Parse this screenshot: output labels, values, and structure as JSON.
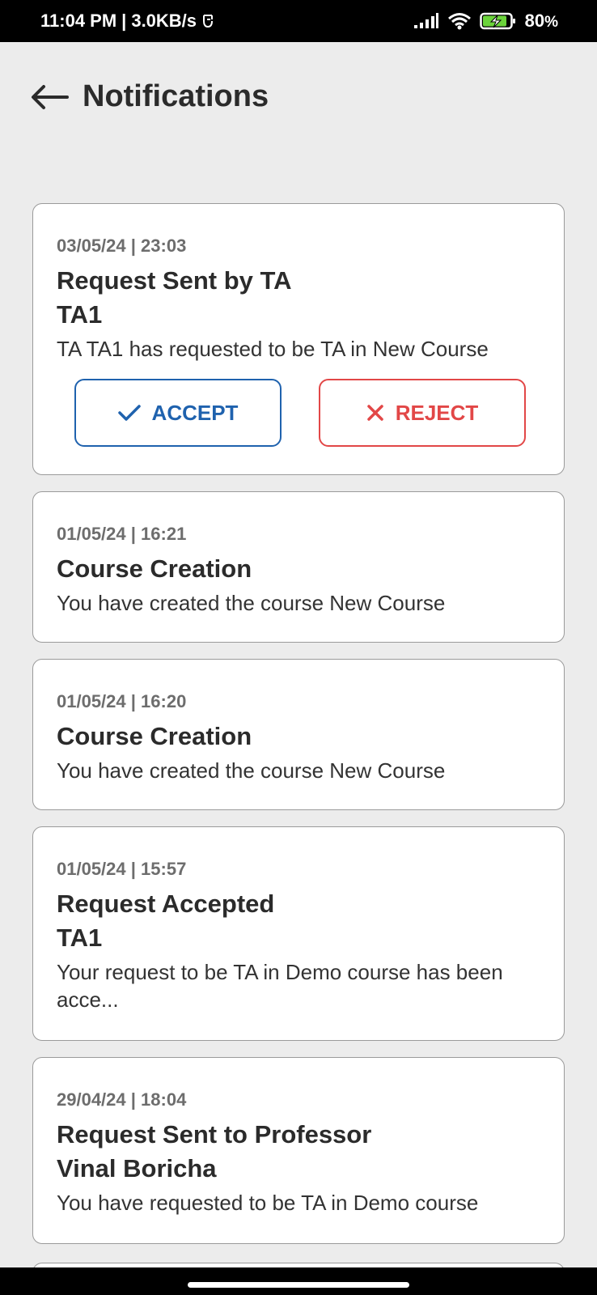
{
  "status_bar": {
    "time": "11:04 PM",
    "separator": "|",
    "speed": "3.0KB/s",
    "battery_percent": "80",
    "battery_suffix": "%",
    "icons": [
      "signal-icon",
      "wifi-icon",
      "battery-charging-icon"
    ]
  },
  "header": {
    "title": "Notifications",
    "back_icon": "back-arrow-icon"
  },
  "notifications": [
    {
      "date": "03/05/24",
      "time": "23:03",
      "title": "Request Sent by TA",
      "subtitle": "TA1",
      "message": "TA TA1 has requested to be TA in New Course",
      "actions": {
        "accept_label": "ACCEPT",
        "reject_label": "REJECT"
      }
    },
    {
      "date": "01/05/24",
      "time": "16:21",
      "title": "Course Creation",
      "message": "You have created the course New Course"
    },
    {
      "date": "01/05/24",
      "time": "16:20",
      "title": "Course Creation",
      "message": "You have created the course New Course"
    },
    {
      "date": "01/05/24",
      "time": "15:57",
      "title": "Request Accepted",
      "subtitle": "TA1",
      "message": "Your request to be TA in Demo course has been acce..."
    },
    {
      "date": "29/04/24",
      "time": "18:04",
      "title": "Request Sent to Professor",
      "subtitle": "Vinal Boricha",
      "message": "You have requested to be TA in Demo course"
    }
  ],
  "colors": {
    "background": "#ececec",
    "accept": "#1f62ae",
    "reject": "#e24747",
    "date_text": "#6d6d6d"
  }
}
